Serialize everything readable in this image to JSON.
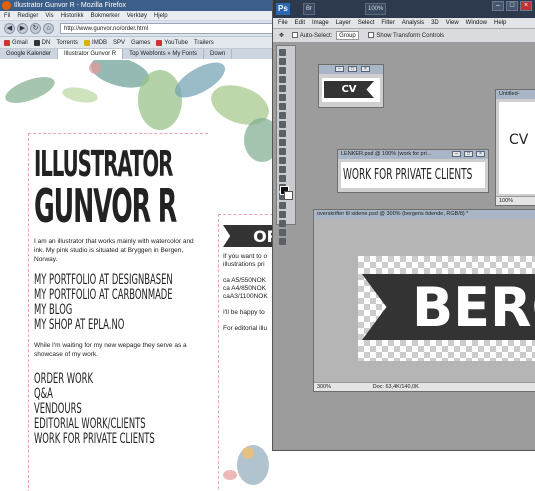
{
  "firefox": {
    "title": "Illustrator Gunvor R - Mozilla Firefox",
    "menu": [
      "Fil",
      "Rediger",
      "Vis",
      "Historikk",
      "Bokmerker",
      "Verktøy",
      "Hjelp"
    ],
    "url": "http://www.gunvor.no/order.html",
    "bookmarks": [
      "Gmail",
      "DN",
      "Torrents",
      "IMDB",
      "SPV",
      "Games",
      "YouTube",
      "Trailers"
    ],
    "tabs": [
      "Google Kalender",
      "Illustrator Gunvor R",
      "Top Webfonts » My Fonts",
      "Down"
    ]
  },
  "site": {
    "title_line1": "ILLUSTRATOR",
    "title_line2": "GUNVOR R",
    "intro": "I am an illustrator that works mainly with watercolor and ink. My pink studio is situated at Bryggen in Bergen, Norway.",
    "links": [
      "MY PORTFOLIO AT DESIGNBASEN",
      "MY PORTFOLIO AT CARBONMADE",
      "MY BLOG",
      "MY SHOP AT EPLA.NO"
    ],
    "waiting": "While I'm waiting for my new wepage they serve as a showcase of my work.",
    "menu": [
      "ORDER WORK",
      "Q&A",
      "VENDOURS",
      "EDITORIAL WORK/CLIENTS",
      "WORK FOR PRIVATE CLIENTS"
    ],
    "order_heading": "OR",
    "order_text": [
      "If you want to o",
      "illustrations pri",
      "ca A5/550NOK",
      "ca A4/850NOK",
      "caA3/1100NOK",
      "I'll be happy to",
      "For editorial illu"
    ]
  },
  "photoshop": {
    "logo": "Ps",
    "bridge": "Br",
    "zoom": "100%",
    "menu": [
      "File",
      "Edit",
      "Image",
      "Layer",
      "Select",
      "Filter",
      "Analysis",
      "3D",
      "View",
      "Window",
      "Help"
    ],
    "options": {
      "auto_select": "Auto-Select:",
      "group": "Group",
      "transform": "Show Transform Controls"
    },
    "docs": {
      "cv_small": {
        "label": "CV"
      },
      "untitled": {
        "title": "Untitled-",
        "label": "CV",
        "zoom": "100%"
      },
      "lenker": {
        "title": "LENKER.psd @ 100% (work for pri...",
        "label": "WORK FOR PRIVATE CLIENTS"
      },
      "overskrifter": {
        "title": "overskrifter til sidene.psd @ 300% (bergens tidende, RGB/8) *",
        "label": "BERGE",
        "zoom": "300%",
        "doc_size": "Doc: 63,4K/140,0K"
      }
    }
  }
}
